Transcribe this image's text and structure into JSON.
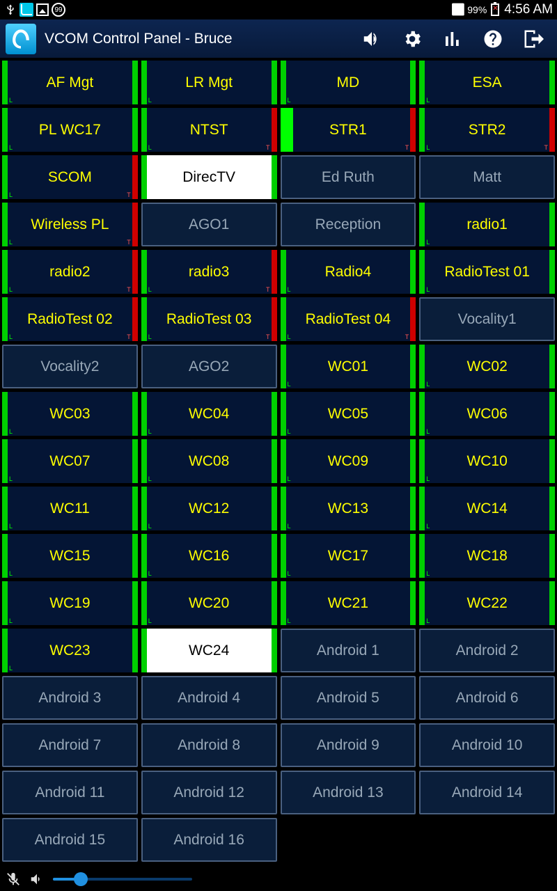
{
  "statusbar": {
    "badge": "99",
    "wifi": true,
    "battery_pct": "99%",
    "clock": "4:56 AM"
  },
  "toolbar": {
    "title": "VCOM Control Panel - Bruce"
  },
  "grid": {
    "cells": [
      {
        "label": "AF Mgt",
        "style": "g",
        "tags": "l"
      },
      {
        "label": "LR Mgt",
        "style": "g",
        "tags": "l"
      },
      {
        "label": "MD",
        "style": "g",
        "tags": "l"
      },
      {
        "label": "ESA",
        "style": "g",
        "tags": "l"
      },
      {
        "label": "PL WC17",
        "style": "g",
        "tags": "l"
      },
      {
        "label": "NTST",
        "style": "g red-r",
        "tags": "lt"
      },
      {
        "label": "STR1",
        "style": "g red-r thick-l",
        "tags": "lt"
      },
      {
        "label": "STR2",
        "style": "g red-r",
        "tags": "lt"
      },
      {
        "label": "SCOM",
        "style": "g red-r",
        "tags": "lt"
      },
      {
        "label": "DirecTV",
        "style": "white"
      },
      {
        "label": "Ed Ruth",
        "style": "grey"
      },
      {
        "label": "Matt",
        "style": "grey"
      },
      {
        "label": "Wireless PL",
        "style": "g red-r",
        "tags": "lt"
      },
      {
        "label": "AGO1",
        "style": "grey"
      },
      {
        "label": "Reception",
        "style": "grey"
      },
      {
        "label": "radio1",
        "style": "g",
        "tags": "l"
      },
      {
        "label": "radio2",
        "style": "g red-r",
        "tags": "lt"
      },
      {
        "label": "radio3",
        "style": "g red-r",
        "tags": "lt"
      },
      {
        "label": "Radio4",
        "style": "g",
        "tags": "l"
      },
      {
        "label": "RadioTest 01",
        "style": "g",
        "tags": "l"
      },
      {
        "label": "RadioTest 02",
        "style": "g red-r",
        "tags": "lt"
      },
      {
        "label": "RadioTest 03",
        "style": "g red-r",
        "tags": "lt"
      },
      {
        "label": "RadioTest 04",
        "style": "g red-r",
        "tags": "lt"
      },
      {
        "label": "Vocality1",
        "style": "grey"
      },
      {
        "label": "Vocality2",
        "style": "grey"
      },
      {
        "label": "AGO2",
        "style": "grey"
      },
      {
        "label": "WC01",
        "style": "g",
        "tags": "l"
      },
      {
        "label": "WC02",
        "style": "g",
        "tags": "l"
      },
      {
        "label": "WC03",
        "style": "g",
        "tags": "l"
      },
      {
        "label": "WC04",
        "style": "g",
        "tags": "l"
      },
      {
        "label": "WC05",
        "style": "g",
        "tags": "l"
      },
      {
        "label": "WC06",
        "style": "g",
        "tags": "l"
      },
      {
        "label": "WC07",
        "style": "g",
        "tags": "l"
      },
      {
        "label": "WC08",
        "style": "g",
        "tags": "l"
      },
      {
        "label": "WC09",
        "style": "g",
        "tags": "l"
      },
      {
        "label": "WC10",
        "style": "g",
        "tags": "l"
      },
      {
        "label": "WC11",
        "style": "g",
        "tags": "l"
      },
      {
        "label": "WC12",
        "style": "g",
        "tags": "l"
      },
      {
        "label": "WC13",
        "style": "g",
        "tags": "l"
      },
      {
        "label": "WC14",
        "style": "g",
        "tags": "l"
      },
      {
        "label": "WC15",
        "style": "g",
        "tags": "l"
      },
      {
        "label": "WC16",
        "style": "g",
        "tags": "l"
      },
      {
        "label": "WC17",
        "style": "g",
        "tags": "l"
      },
      {
        "label": "WC18",
        "style": "g",
        "tags": "l"
      },
      {
        "label": "WC19",
        "style": "g",
        "tags": "l"
      },
      {
        "label": "WC20",
        "style": "g",
        "tags": "l"
      },
      {
        "label": "WC21",
        "style": "g",
        "tags": "l"
      },
      {
        "label": "WC22",
        "style": "g",
        "tags": "l"
      },
      {
        "label": "WC23",
        "style": "g",
        "tags": "l"
      },
      {
        "label": "WC24",
        "style": "white"
      },
      {
        "label": "Android  1",
        "style": "grey"
      },
      {
        "label": "Android  2",
        "style": "grey"
      },
      {
        "label": "Android  3",
        "style": "grey"
      },
      {
        "label": "Android  4",
        "style": "grey"
      },
      {
        "label": "Android  5",
        "style": "grey"
      },
      {
        "label": "Android  6",
        "style": "grey"
      },
      {
        "label": "Android  7",
        "style": "grey"
      },
      {
        "label": "Android  8",
        "style": "grey"
      },
      {
        "label": "Android  9",
        "style": "grey"
      },
      {
        "label": "Android 10",
        "style": "grey"
      },
      {
        "label": "Android 11",
        "style": "grey"
      },
      {
        "label": "Android 12",
        "style": "grey"
      },
      {
        "label": "Android 13",
        "style": "grey"
      },
      {
        "label": "Android 14",
        "style": "grey"
      },
      {
        "label": "Android 15",
        "style": "grey"
      },
      {
        "label": "Android 16",
        "style": "grey"
      }
    ]
  },
  "bottom": {
    "slider_pct": 20
  }
}
